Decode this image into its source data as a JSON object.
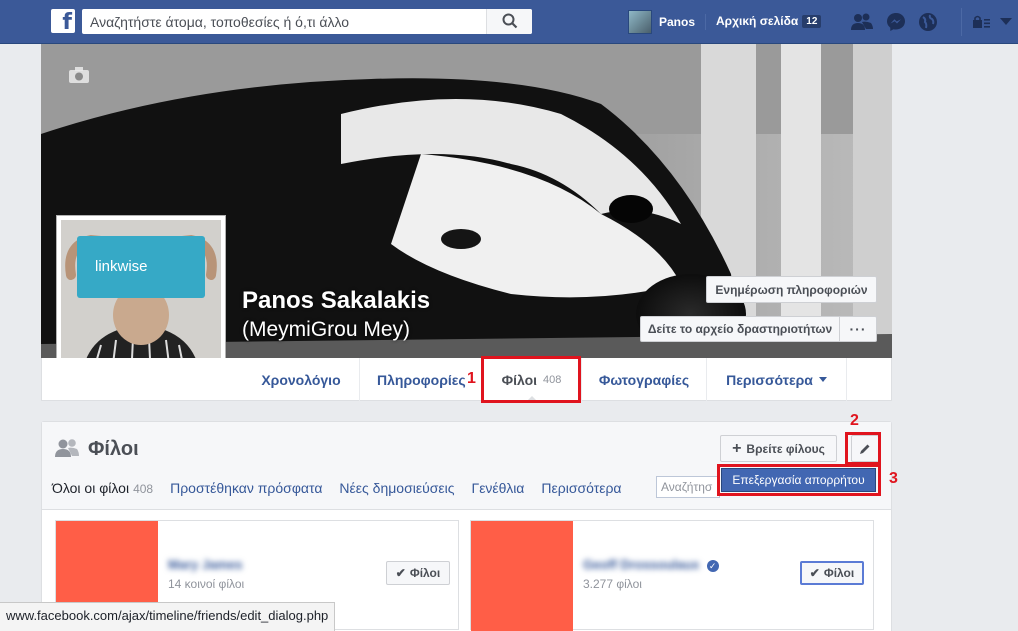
{
  "topbar": {
    "search_placeholder": "Αναζητήστε άτομα, τοποθεσίες ή ό,τι άλλο",
    "user_name": "Panos",
    "home_label": "Αρχική σελίδα",
    "home_count": "12"
  },
  "profile": {
    "name": "Panos Sakalakis",
    "alt_name": "(MeymiGrou Mey)",
    "picture_text": "linkwise",
    "update_info_label": "Ενημέρωση πληροφοριών",
    "activity_log_label": "Δείτε το αρχείο δραστηριοτήτων",
    "more_label": "···"
  },
  "profile_nav": {
    "tabs": [
      {
        "label": "Χρονολόγιο"
      },
      {
        "label": "Πληροφορίες"
      },
      {
        "label": "Φίλοι",
        "count": "408"
      },
      {
        "label": "Φωτογραφίες"
      },
      {
        "label": "Περισσότερα"
      }
    ]
  },
  "annotations": [
    "1",
    "2",
    "3"
  ],
  "friends": {
    "title": "Φίλοι",
    "find_label": "Βρείτε φίλους",
    "edit_privacy_label": "Επεξεργασία απορρήτου",
    "search_placeholder": "Αναζήτησ",
    "subtabs": [
      {
        "label": "Όλοι οι φίλοι",
        "count": "408"
      },
      {
        "label": "Προστέθηκαν πρόσφατα"
      },
      {
        "label": "Νέες δημοσιεύσεις"
      },
      {
        "label": "Γενέθλια"
      },
      {
        "label": "Περισσότερα"
      }
    ],
    "cards": [
      {
        "name": "Mary James",
        "mutual": "14 κοινοί φίλοι",
        "button": "Φίλοι"
      },
      {
        "name": "Geoff Drossoulaux",
        "mutual": "3.277 φίλοι",
        "button": "Φίλοι"
      }
    ]
  },
  "statusbar": {
    "url": "www.facebook.com/ajax/timeline/friends/edit_dialog.php"
  },
  "colors": {
    "brand": "#3b5998",
    "annotation": "#e0141e",
    "link": "#365899",
    "friend_photo": "#ff5e47"
  }
}
